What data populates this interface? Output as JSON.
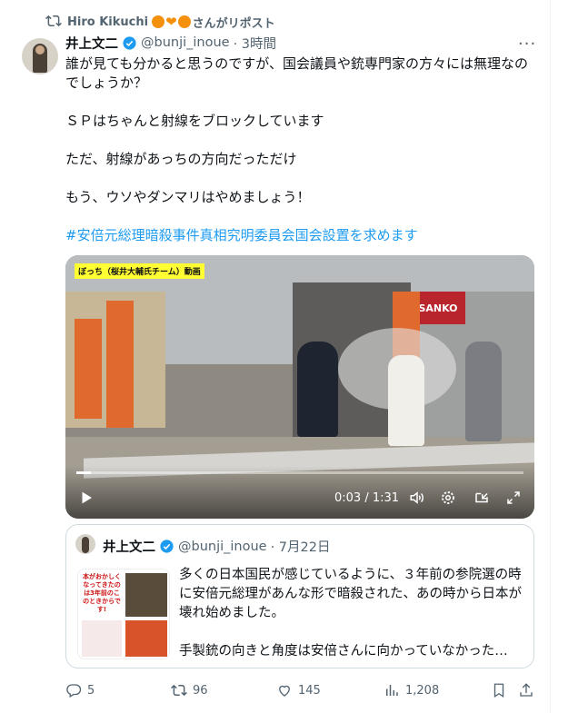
{
  "repost": {
    "label": "Hiro Kikuchi",
    "suffix": "さんがリポスト"
  },
  "tweet": {
    "name": "井上文二",
    "handle": "@bunji_inoue",
    "time": "· 3時間",
    "lines": [
      "誰が見ても分かると思うのですが、国会議員や銃専門家の方々には無理なのでしょうか？",
      "ＳＰはちゃんと射線をブロックしています",
      "ただ、射線があっちの方向だっただけ",
      "もう、ウソやダンマリはやめましょう！"
    ],
    "hashtag": "#安倍元総理暗殺事件真相究明委員会国会設置を求めます"
  },
  "video": {
    "caption": "ぼっち（桜井大輔氏チーム）動画",
    "sign_text": "SANKO",
    "current_time": "0:03",
    "duration": "1:31",
    "time_display": "0:03 / 1:31",
    "progress": 0.033
  },
  "quote": {
    "name": "井上文二",
    "handle": "@bunji_inoue",
    "time": "· 7月22日",
    "text1": "多くの日本国民が感じているように、３年前の参院選の時に安倍元総理があんな形で暗殺された、あの時から日本が壊れ始めました。",
    "text2": "手製銃の向きと角度は安倍さんに向かっていなかった…",
    "thumb_text": "本がおかしくなってきたのは3年前のこのときからです!"
  },
  "actions": {
    "replies": "5",
    "reposts": "96",
    "likes": "145",
    "views": "1,208"
  },
  "colors": {
    "link": "#1d9bf0",
    "muted": "#536471",
    "verified": "#1d9bf0"
  }
}
